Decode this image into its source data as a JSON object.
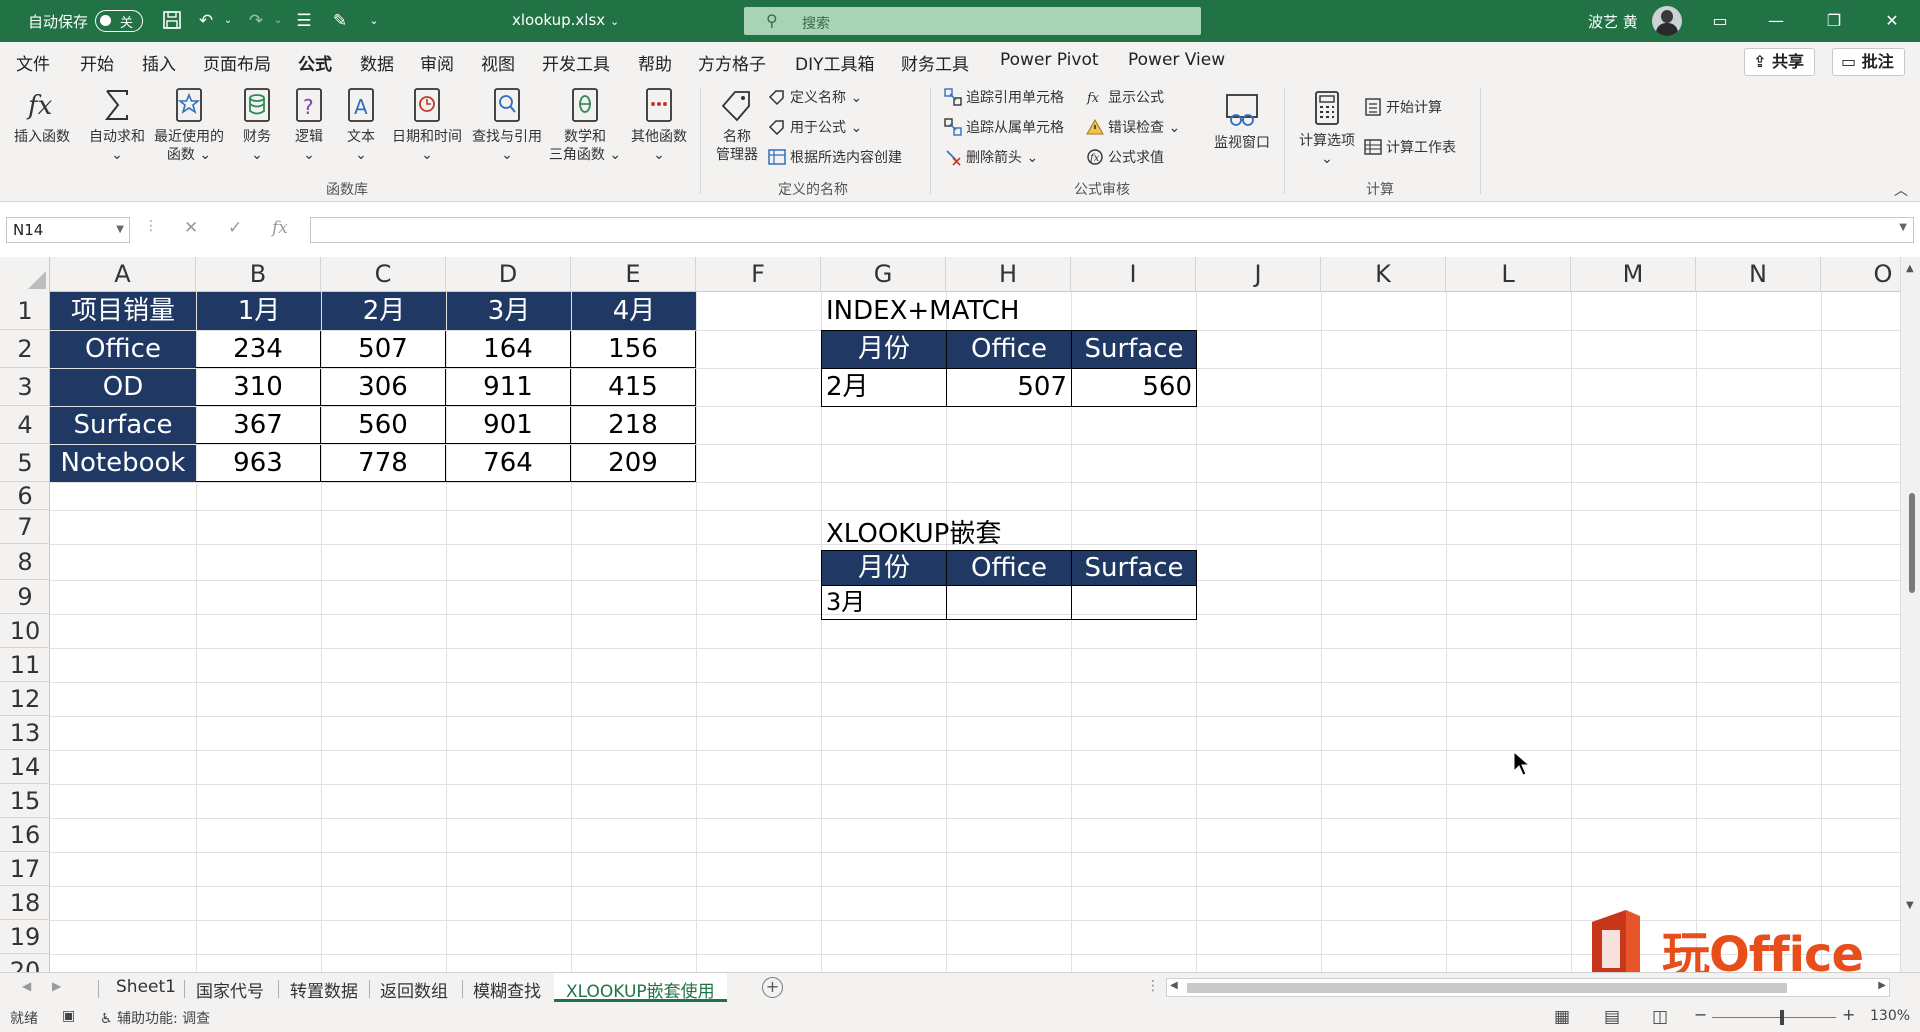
{
  "titlebar": {
    "autosave_label": "自动保存",
    "autosave_state": "关",
    "filename": "xlookup.xlsx",
    "filename_chevron": "⌄",
    "search_placeholder": "搜索",
    "user_name": "波艺 黄",
    "accent_color": "#217346"
  },
  "menu": {
    "tabs": [
      "文件",
      "开始",
      "插入",
      "页面布局",
      "公式",
      "数据",
      "审阅",
      "视图",
      "开发工具",
      "帮助",
      "方方格子",
      "DIY工具箱",
      "财务工具",
      "Power Pivot",
      "Power View"
    ],
    "active_tab": "公式",
    "share_label": "共享",
    "comment_label": "批注"
  },
  "ribbon": {
    "function_library": {
      "label": "函数库",
      "buttons": [
        {
          "line1": "插入函数",
          "line2": "",
          "icon": "fx-icon"
        },
        {
          "line1": "自动求和",
          "line2": "⌄",
          "icon": "sigma-icon"
        },
        {
          "line1": "最近使用的",
          "line2": "函数 ⌄",
          "icon": "star-book-icon"
        },
        {
          "line1": "财务",
          "line2": "⌄",
          "icon": "database-icon"
        },
        {
          "line1": "逻辑",
          "line2": "⌄",
          "icon": "question-book-icon"
        },
        {
          "line1": "文本",
          "line2": "⌄",
          "icon": "text-book-icon"
        },
        {
          "line1": "日期和时间",
          "line2": "⌄",
          "icon": "clock-book-icon"
        },
        {
          "line1": "查找与引用",
          "line2": "⌄",
          "icon": "search-book-icon"
        },
        {
          "line1": "数学和",
          "line2": "三角函数 ⌄",
          "icon": "theta-book-icon"
        },
        {
          "line1": "其他函数",
          "line2": "⌄",
          "icon": "more-book-icon"
        }
      ]
    },
    "defined_names": {
      "label": "定义的名称",
      "manager_line1": "名称",
      "manager_line2": "管理器",
      "define_name": "定义名称  ⌄",
      "use_in_formula": "用于公式 ⌄",
      "create_from_selection": "根据所选内容创建"
    },
    "formula_auditing": {
      "label": "公式审核",
      "trace_precedents": "追踪引用单元格",
      "trace_dependents": "追踪从属单元格",
      "remove_arrows": "删除箭头   ⌄",
      "show_formulas": "显示公式",
      "error_checking": "错误检查   ⌄",
      "evaluate_formula": "公式求值",
      "watch_window": "监视窗口"
    },
    "calculation": {
      "label": "计算",
      "options_line1": "计算选项",
      "options_line2": "⌄",
      "calculate_now": "开始计算",
      "calculate_sheet": "计算工作表"
    }
  },
  "formula_bar": {
    "name_box": "N14",
    "formula": ""
  },
  "grid": {
    "columns": [
      "A",
      "B",
      "C",
      "D",
      "E",
      "F",
      "G",
      "H",
      "I",
      "J",
      "K",
      "L",
      "M",
      "N",
      "O"
    ],
    "rows": [
      "1",
      "2",
      "3",
      "4",
      "5",
      "6",
      "7",
      "8",
      "9",
      "10",
      "11",
      "12",
      "13",
      "14",
      "15",
      "16",
      "17",
      "18",
      "19",
      "20"
    ],
    "header_fill": "#203864",
    "sales_table": {
      "headers": [
        "项目销量",
        "1月",
        "2月",
        "3月",
        "4月"
      ],
      "rows": [
        {
          "label": "Office",
          "values": [
            "234",
            "507",
            "164",
            "156"
          ]
        },
        {
          "label": "OD",
          "values": [
            "310",
            "306",
            "911",
            "415"
          ]
        },
        {
          "label": "Surface",
          "values": [
            "367",
            "560",
            "901",
            "218"
          ]
        },
        {
          "label": "Notebook",
          "values": [
            "963",
            "778",
            "764",
            "209"
          ]
        }
      ]
    },
    "index_match": {
      "title": "INDEX+MATCH",
      "headers": [
        "月份",
        "Office",
        "Surface"
      ],
      "row": [
        "2月",
        "507",
        "560"
      ]
    },
    "xlookup": {
      "title": "XLOOKUP嵌套",
      "headers": [
        "月份",
        "Office",
        "Surface"
      ],
      "row": [
        "3月",
        "",
        ""
      ]
    }
  },
  "sheets": {
    "tabs": [
      "Sheet1",
      "国家代号",
      "转置数据",
      "返回数组",
      "模糊查找",
      "XLOOKUP嵌套使用"
    ],
    "active": "XLOOKUP嵌套使用"
  },
  "status": {
    "ready": "就绪",
    "accessibility": "辅助功能: 调查",
    "zoom": "130%"
  },
  "watermark": {
    "text": "玩Office"
  }
}
